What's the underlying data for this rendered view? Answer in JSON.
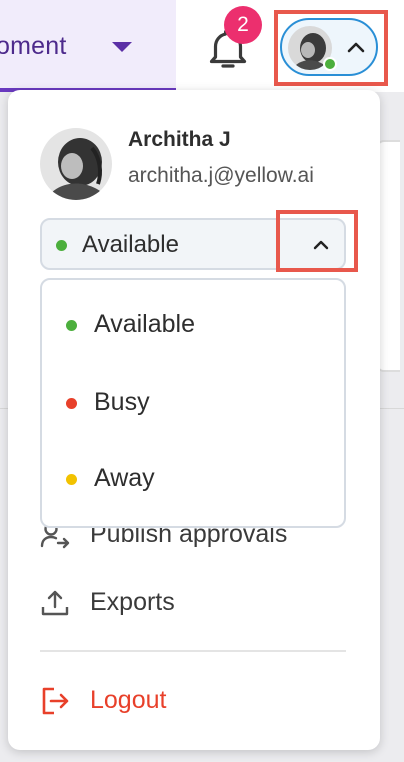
{
  "header": {
    "environment_label": "oment",
    "notifications": {
      "count": "2",
      "icon": "bell-icon"
    }
  },
  "profile_menu": {
    "user": {
      "name": "Architha J",
      "email": "architha.j@yellow.ai"
    },
    "status": {
      "current": "Available",
      "current_color": "#4caf3d",
      "options": [
        {
          "label": "Available",
          "color": "#4caf3d"
        },
        {
          "label": "Busy",
          "color": "#e8402a"
        },
        {
          "label": "Away",
          "color": "#f2c200"
        }
      ]
    },
    "items": [
      {
        "label": "Publish approvals",
        "icon": "user-arrow-icon"
      },
      {
        "label": "Exports",
        "icon": "upload-icon"
      }
    ],
    "logout": {
      "label": "Logout",
      "icon": "logout-icon",
      "color": "#e8402a"
    }
  }
}
